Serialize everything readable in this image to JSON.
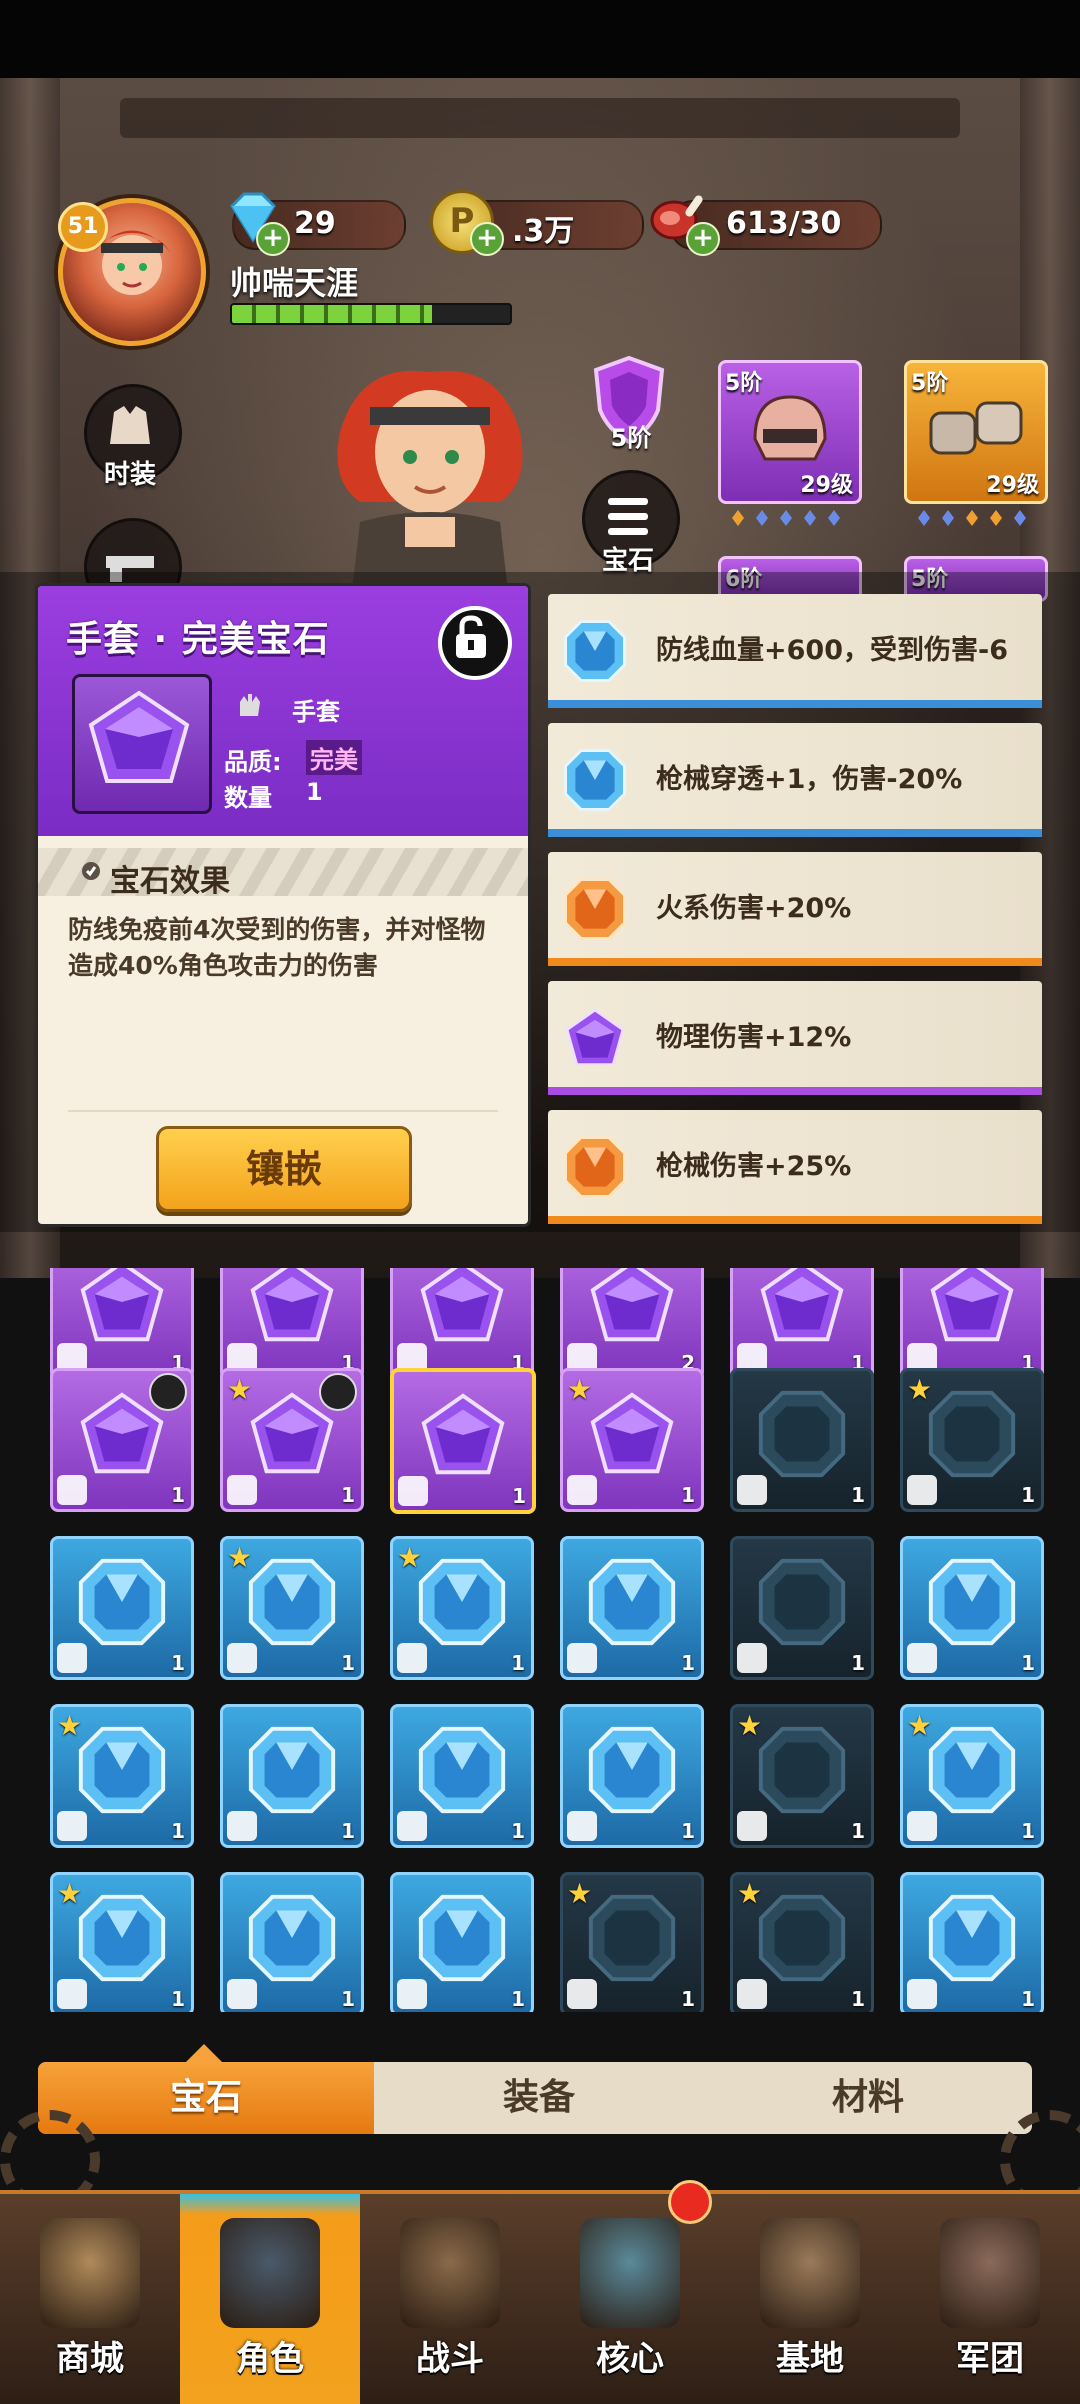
{
  "header": {
    "level": "51",
    "player_name": "帅喘天涯",
    "diamonds": "29",
    "gold": ".3万",
    "gold_icon_text": "P",
    "stamina": "613/30"
  },
  "side_buttons": {
    "fashion": "时装",
    "gem": "宝石"
  },
  "equipment": {
    "shield_rank": "5阶",
    "slots": [
      {
        "rank": "5阶",
        "level": "29级",
        "quality": "purple"
      },
      {
        "rank": "5阶",
        "level": "29级",
        "quality": "orange"
      },
      {
        "rank": "6阶",
        "level": "",
        "quality": "purple"
      },
      {
        "rank": "5阶",
        "level": "",
        "quality": "purple"
      }
    ]
  },
  "detail_panel": {
    "title": "手套 · 完美宝石",
    "slot_type": "手套",
    "quality_label": "品质:",
    "quality_value": "完美",
    "count_label": "数量",
    "count_value": "1",
    "effect_title": "宝石效果",
    "effect_desc": "防线免疫前4次受到的伤害，并对怪物造成40%角色攻击力的伤害",
    "inlay_button": "镶嵌"
  },
  "options": [
    {
      "text": "防线血量+600，受到伤害-6",
      "gem": "blue",
      "bar_color": "#3a8fd8"
    },
    {
      "text": "枪械穿透+1，伤害-20%",
      "gem": "blue",
      "bar_color": "#3a8fd8"
    },
    {
      "text": "火系伤害+20%",
      "gem": "orange",
      "bar_color": "#f08a1a"
    },
    {
      "text": "物理伤害+12%",
      "gem": "purple",
      "bar_color": "#a94ee0"
    },
    {
      "text": "枪械伤害+25%",
      "gem": "orange",
      "bar_color": "#f08a1a"
    }
  ],
  "inventory": {
    "rows": [
      [
        {
          "t": "p",
          "n": "1"
        },
        {
          "t": "p",
          "n": "1"
        },
        {
          "t": "p",
          "n": "1"
        },
        {
          "t": "p",
          "n": "2"
        },
        {
          "t": "p",
          "n": "1"
        },
        {
          "t": "p",
          "n": "1"
        }
      ],
      [
        {
          "t": "p",
          "n": "1",
          "lock": true
        },
        {
          "t": "p",
          "n": "1",
          "star": true,
          "lock": true
        },
        {
          "t": "p",
          "n": "1",
          "sel": true
        },
        {
          "t": "p",
          "n": "1",
          "star": true
        },
        {
          "t": "d",
          "n": "1"
        },
        {
          "t": "d",
          "n": "1",
          "star": true
        }
      ],
      [
        {
          "t": "b",
          "n": "1"
        },
        {
          "t": "b",
          "n": "1",
          "star": true
        },
        {
          "t": "b",
          "n": "1",
          "star": true
        },
        {
          "t": "b",
          "n": "1"
        },
        {
          "t": "d",
          "n": "1"
        },
        {
          "t": "b",
          "n": "1"
        }
      ],
      [
        {
          "t": "b",
          "n": "1",
          "star": true
        },
        {
          "t": "b",
          "n": "1"
        },
        {
          "t": "b",
          "n": "1"
        },
        {
          "t": "b",
          "n": "1"
        },
        {
          "t": "d",
          "n": "1",
          "star": true
        },
        {
          "t": "b",
          "n": "1",
          "star": true
        }
      ],
      [
        {
          "t": "b",
          "n": "1",
          "star": true
        },
        {
          "t": "b",
          "n": "1"
        },
        {
          "t": "b",
          "n": "1"
        },
        {
          "t": "d",
          "n": "1",
          "star": true
        },
        {
          "t": "d",
          "n": "1",
          "star": true
        },
        {
          "t": "b",
          "n": "1"
        }
      ]
    ]
  },
  "tabs": [
    {
      "label": "宝石",
      "active": true
    },
    {
      "label": "装备",
      "active": false
    },
    {
      "label": "材料",
      "active": false
    }
  ],
  "nav": [
    {
      "label": "商城",
      "active": false,
      "icon": "shop-icon"
    },
    {
      "label": "角色",
      "active": true,
      "icon": "character-icon"
    },
    {
      "label": "战斗",
      "active": false,
      "icon": "battle-icon"
    },
    {
      "label": "核心",
      "active": false,
      "icon": "core-icon"
    },
    {
      "label": "基地",
      "active": false,
      "icon": "base-icon"
    },
    {
      "label": "军团",
      "active": false,
      "icon": "legion-icon"
    }
  ],
  "colors": {
    "accent_orange": "#f2a21e",
    "gem_purple": "#8a3ed0",
    "gem_blue": "#2f8fd6"
  }
}
